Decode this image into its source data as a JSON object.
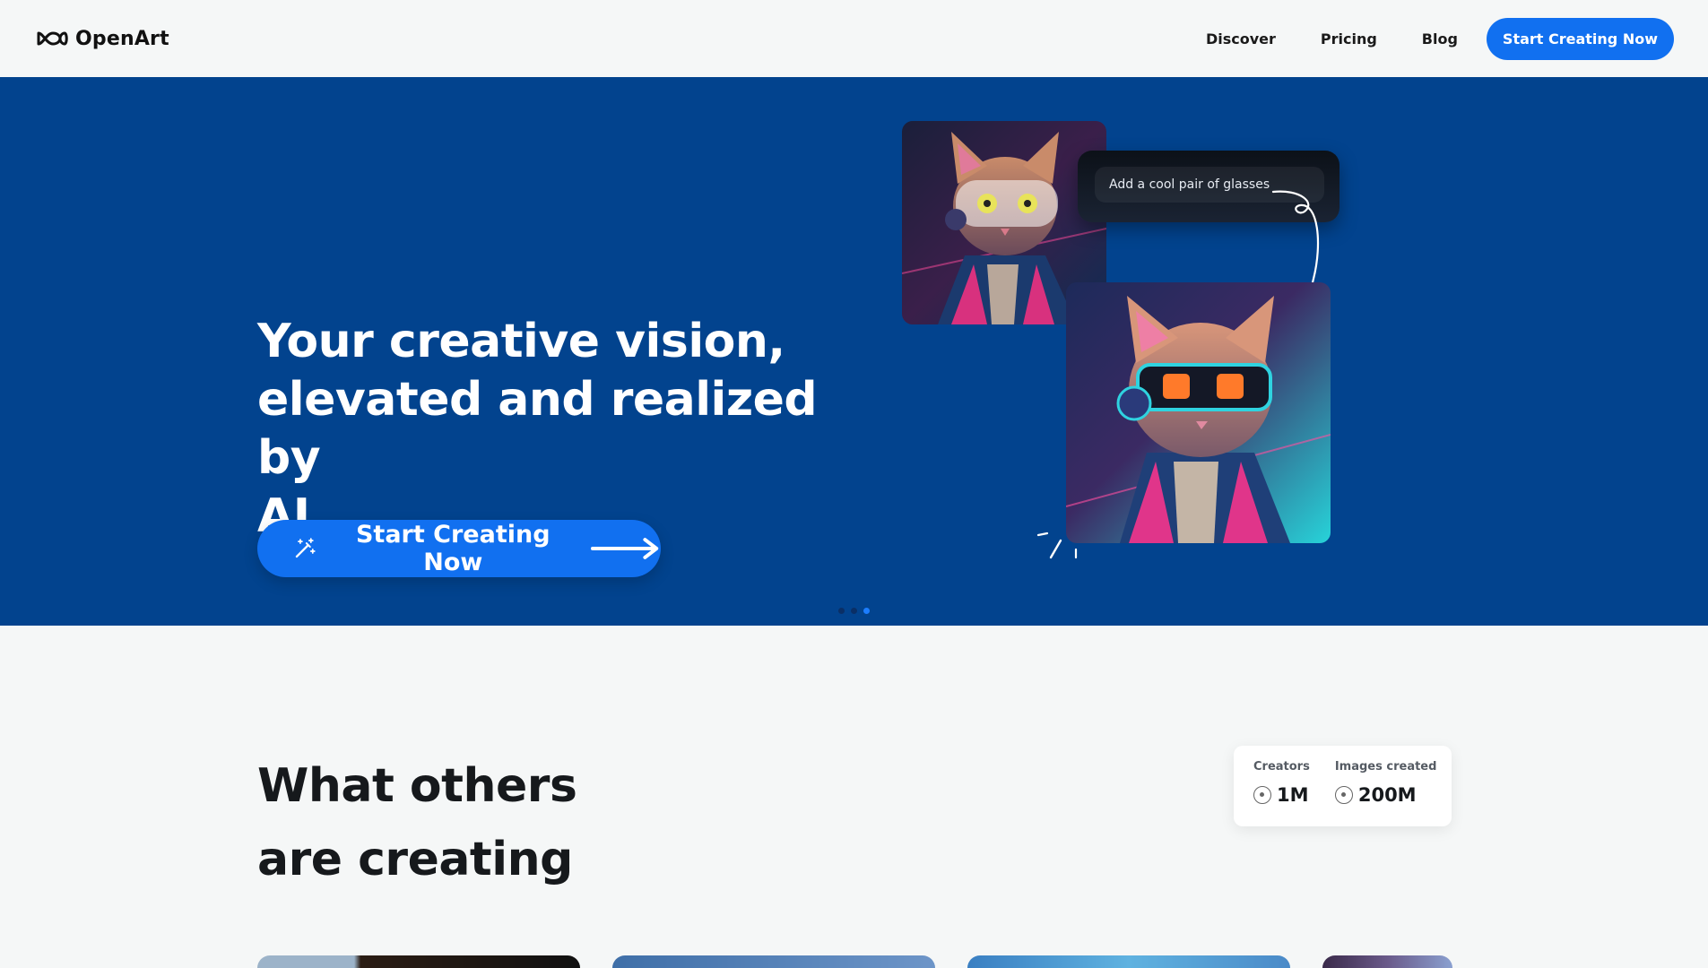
{
  "header": {
    "logo_text": "OpenArt",
    "nav": [
      {
        "label": "Discover"
      },
      {
        "label": "Pricing"
      },
      {
        "label": "Blog"
      }
    ],
    "cta_label": "Start Creating Now"
  },
  "hero": {
    "title_line1": "Your creative vision,",
    "title_line2": "elevated and realized by",
    "title_line3": "AI",
    "cta_label": "Start Creating Now",
    "prompt_text": "Add a cool pair of glasses",
    "carousel": {
      "slides": 3,
      "active": 3
    },
    "colors": {
      "background": "#02438e",
      "accent": "#1170f0"
    }
  },
  "creating": {
    "title_line1": "What others",
    "title_line2": "are creating",
    "stats": [
      {
        "label": "Creators",
        "value": "1M"
      },
      {
        "label": "Images created",
        "value": "200M"
      }
    ]
  }
}
